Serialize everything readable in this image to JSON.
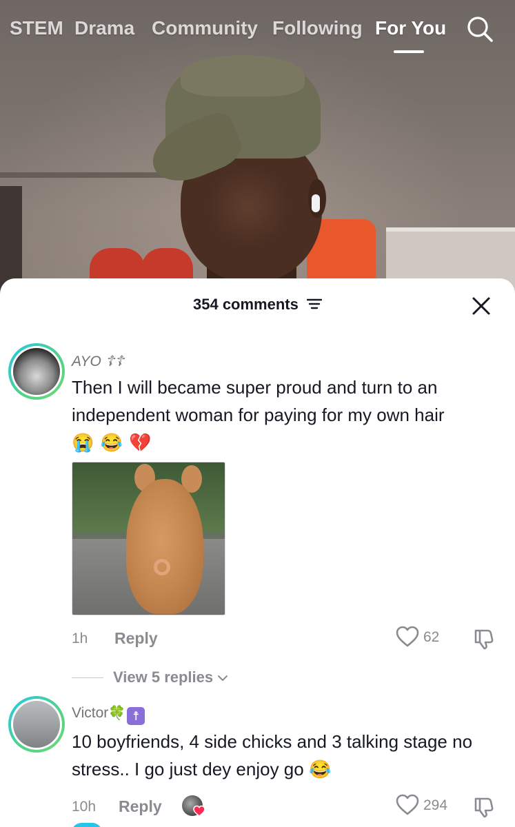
{
  "topnav": {
    "tabs": [
      {
        "label": "STEM"
      },
      {
        "label": "Drama"
      },
      {
        "label": "Community"
      },
      {
        "label": "Following"
      },
      {
        "label": "For You"
      }
    ],
    "active_tab": "For You",
    "search_icon": "search-icon"
  },
  "sheet": {
    "title": "354 comments",
    "sort_icon": "sort-icon",
    "close_icon": "close-icon"
  },
  "comments": [
    {
      "username": "AYO ☦☦",
      "text": "Then I will became super proud and turn to an independent woman for paying for my own hair",
      "emojis": [
        "😭",
        "😂",
        "💔"
      ],
      "has_image": true,
      "age": "1h",
      "reply_label": "Reply",
      "likes": "62",
      "view_replies": "View 5 replies"
    },
    {
      "username": "Victor",
      "badges": [
        "🍀",
        "☨"
      ],
      "text": "10 boyfriends, 4 side chicks and 3 talking stage no stress.. I go just dey enjoy go",
      "emojis": [
        "😂"
      ],
      "age": "10h",
      "reply_label": "Reply",
      "likes": "294"
    }
  ],
  "colors": {
    "text_primary": "#161823",
    "text_secondary": "#8a8b91",
    "avatar_ring_start": "#26c6e8",
    "avatar_ring_end": "#6fd67a",
    "heart_red": "#fe2c55"
  }
}
